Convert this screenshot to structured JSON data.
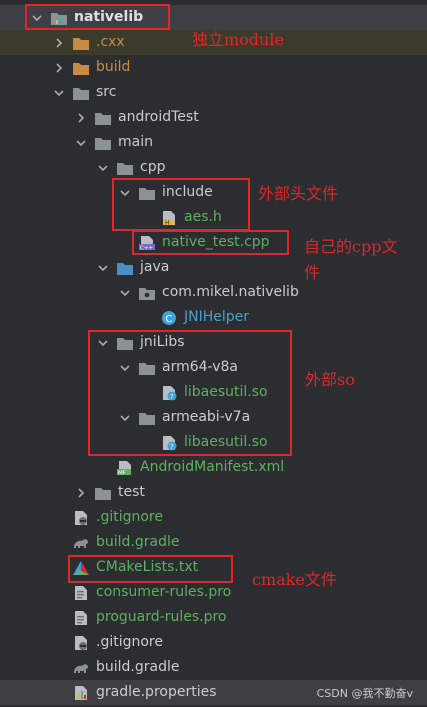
{
  "tree": [
    {
      "label": "nativelib",
      "level": 0,
      "chevron": "down",
      "icon": "module-folder-icon",
      "color": "bold",
      "row_style": "sel"
    },
    {
      "label": ".cxx",
      "level": 2,
      "chevron": "right",
      "icon": "orange-folder-icon",
      "color": "orange",
      "row_style": "hl"
    },
    {
      "label": "build",
      "level": 2,
      "chevron": "right",
      "icon": "orange-folder-icon",
      "color": "orange",
      "row_style": ""
    },
    {
      "label": "src",
      "level": 2,
      "chevron": "down",
      "icon": "folder-icon",
      "color": "default",
      "row_style": ""
    },
    {
      "label": "androidTest",
      "level": 3,
      "chevron": "right",
      "icon": "folder-icon",
      "color": "default",
      "row_style": ""
    },
    {
      "label": "main",
      "level": 3,
      "chevron": "down",
      "icon": "folder-icon",
      "color": "default",
      "row_style": ""
    },
    {
      "label": "cpp",
      "level": 4,
      "chevron": "down",
      "icon": "folder-icon",
      "color": "default",
      "row_style": ""
    },
    {
      "label": "include",
      "level": 5,
      "chevron": "down",
      "icon": "folder-icon",
      "color": "default",
      "row_style": ""
    },
    {
      "label": "aes.h",
      "level": 6,
      "chevron": "",
      "icon": "header-file-icon",
      "color": "green",
      "row_style": ""
    },
    {
      "label": "native_test.cpp",
      "level": 5,
      "chevron": "",
      "icon": "cpp-file-icon",
      "color": "green",
      "row_style": ""
    },
    {
      "label": "java",
      "level": 4,
      "chevron": "down",
      "icon": "blue-folder-icon",
      "color": "default",
      "row_style": ""
    },
    {
      "label": "com.mikel.nativelib",
      "level": 5,
      "chevron": "down",
      "icon": "package-icon",
      "color": "default",
      "row_style": ""
    },
    {
      "label": "JNIHelper",
      "level": 6,
      "chevron": "",
      "icon": "class-icon",
      "color": "blue",
      "row_style": ""
    },
    {
      "label": "jniLibs",
      "level": 4,
      "chevron": "down",
      "icon": "folder-icon",
      "color": "default",
      "row_style": ""
    },
    {
      "label": "arm64-v8a",
      "level": 5,
      "chevron": "down",
      "icon": "folder-icon",
      "color": "default",
      "row_style": ""
    },
    {
      "label": "libaesutil.so",
      "level": 6,
      "chevron": "",
      "icon": "unknown-file-icon",
      "color": "green",
      "row_style": ""
    },
    {
      "label": "armeabi-v7a",
      "level": 5,
      "chevron": "down",
      "icon": "folder-icon",
      "color": "default",
      "row_style": ""
    },
    {
      "label": "libaesutil.so",
      "level": 6,
      "chevron": "",
      "icon": "unknown-file-icon",
      "color": "green",
      "row_style": ""
    },
    {
      "label": "AndroidManifest.xml",
      "level": 4,
      "chevron": "",
      "icon": "manifest-file-icon",
      "color": "green",
      "row_style": ""
    },
    {
      "label": "test",
      "level": 3,
      "chevron": "right",
      "icon": "folder-icon",
      "color": "default",
      "row_style": ""
    },
    {
      "label": ".gitignore",
      "level": 2,
      "chevron": "",
      "icon": "gitignore-file-icon",
      "color": "green",
      "row_style": ""
    },
    {
      "label": "build.gradle",
      "level": 2,
      "chevron": "",
      "icon": "gradle-file-icon",
      "color": "green",
      "row_style": ""
    },
    {
      "label": "CMakeLists.txt",
      "level": 2,
      "chevron": "",
      "icon": "cmake-file-icon",
      "color": "green",
      "row_style": ""
    },
    {
      "label": "consumer-rules.pro",
      "level": 2,
      "chevron": "",
      "icon": "pro-file-icon",
      "color": "green",
      "row_style": ""
    },
    {
      "label": "proguard-rules.pro",
      "level": 2,
      "chevron": "",
      "icon": "pro-file-icon",
      "color": "green",
      "row_style": ""
    },
    {
      "label": ".gitignore",
      "level": 1,
      "chevron": "",
      "icon": "gitignore-file-icon",
      "color": "default",
      "row_style": ""
    },
    {
      "label": "build.gradle",
      "level": 1,
      "chevron": "",
      "icon": "gradle-file-icon",
      "color": "default",
      "row_style": ""
    },
    {
      "label": "gradle.properties",
      "level": 1,
      "chevron": "",
      "icon": "properties-file-icon",
      "color": "default",
      "row_style": "sel"
    }
  ],
  "annotations": {
    "module": "独立module",
    "header": "外部头文件",
    "own_cpp_line1": "自己的cpp文",
    "own_cpp_line2": "件",
    "external_so": "外部so",
    "cmake": "cmake文件"
  },
  "watermark": "CSDN @我不勤奋v",
  "colors": {
    "background": "#2b2d30",
    "annotation": "#e0262b",
    "green_file": "#5fb05f",
    "orange_folder": "#c98b43",
    "blue_class": "#4ca1c9"
  }
}
